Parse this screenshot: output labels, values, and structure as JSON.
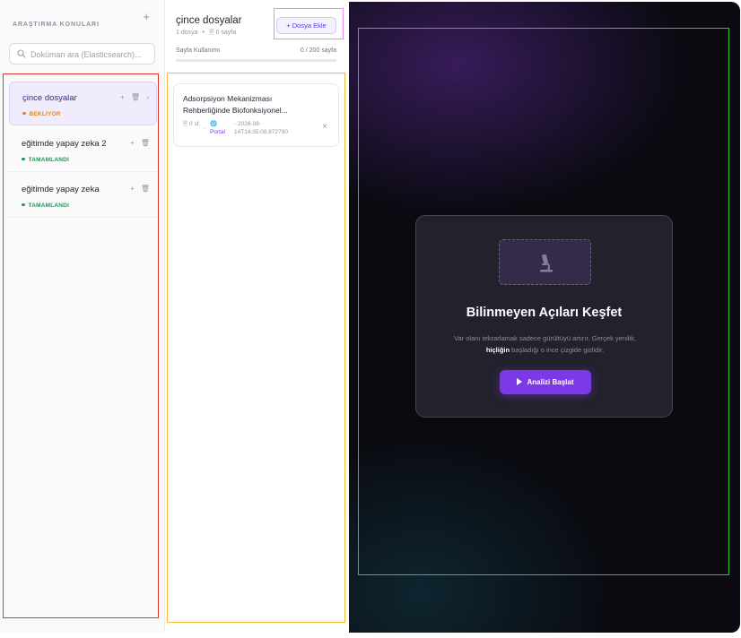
{
  "sidebar": {
    "title": "ARAŞTIRMA KONULARI",
    "add_symbol": "+",
    "search_placeholder": "Doküman ara (Elasticsearch)...",
    "topics": [
      {
        "name": "çince dosyalar",
        "status": "BEKLİYOR",
        "status_color": "#e0891a",
        "active": true
      },
      {
        "name": "eğitimde yapay zeka 2",
        "status": "TAMAMLANDI",
        "status_color": "#1a9b55",
        "active": false
      },
      {
        "name": "eğitimde yapay zeka",
        "status": "TAMAMLANDI",
        "status_color": "#1a9b55",
        "active": false
      }
    ]
  },
  "middle": {
    "title": "çince dosyalar",
    "file_count": "1 dosya",
    "page_count": "0 sayfa",
    "add_file_label": "+ Dosya Ekle",
    "usage_label": "Sayfa Kullanımı",
    "usage_value": "0 / 200 sayfa",
    "usage_fraction": 0,
    "files": [
      {
        "title": "Adsorpsiyon Mekanizması Rehberliğinde Biofonksiyonel...",
        "pages": "0 sf.",
        "source": "Portal",
        "date": "- 2026-08-14T14:35:08.872790",
        "close": "×"
      }
    ]
  },
  "discover": {
    "title": "Bilinmeyen Açıları Keşfet",
    "text_before": "Var olanı tekrarlamak sadece gürültüyü artırır. Gerçek yenilik,",
    "text_bold": "hiçliğin",
    "text_after": "başladığı o ince çizgide gizlidir.",
    "button_label": "Analizi Başlat"
  },
  "colors": {
    "accent": "#7b3ae6",
    "pending": "#e0891a",
    "done": "#1a9b55"
  }
}
